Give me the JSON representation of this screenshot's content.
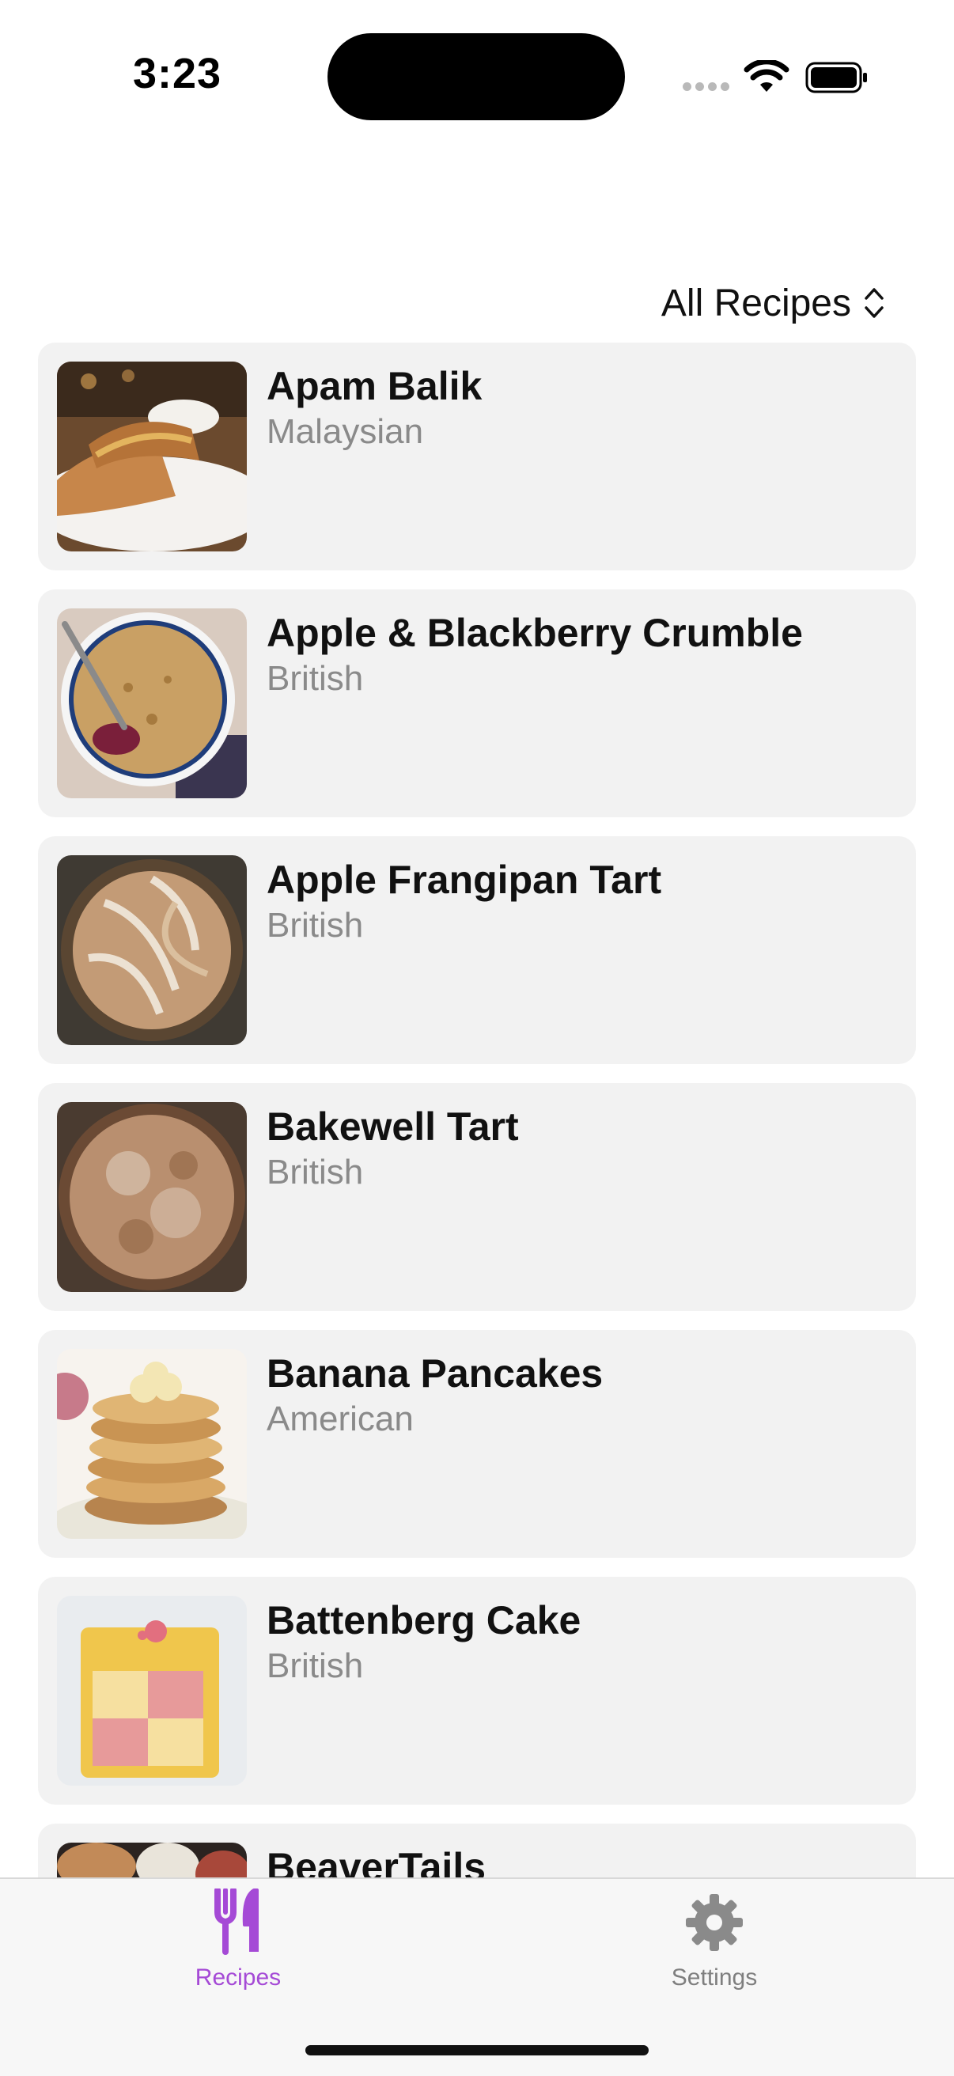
{
  "status_bar": {
    "time": "3:23"
  },
  "header": {
    "filter_label": "All Recipes"
  },
  "recipes": [
    {
      "name": "Apam Balik",
      "cuisine": "Malaysian"
    },
    {
      "name": "Apple & Blackberry Crumble",
      "cuisine": "British"
    },
    {
      "name": "Apple Frangipan Tart",
      "cuisine": "British"
    },
    {
      "name": "Bakewell Tart",
      "cuisine": "British"
    },
    {
      "name": "Banana Pancakes",
      "cuisine": "American"
    },
    {
      "name": "Battenberg Cake",
      "cuisine": "British"
    },
    {
      "name": "BeaverTails",
      "cuisine": ""
    }
  ],
  "tab_bar": {
    "tabs": [
      {
        "label": "Recipes",
        "icon": "fork-knife-icon",
        "active": true
      },
      {
        "label": "Settings",
        "icon": "gear-icon",
        "active": false
      }
    ]
  },
  "colors": {
    "accent": "#a54ad6",
    "card_background": "#f2f2f2",
    "secondary_text": "#8a8a8a"
  }
}
